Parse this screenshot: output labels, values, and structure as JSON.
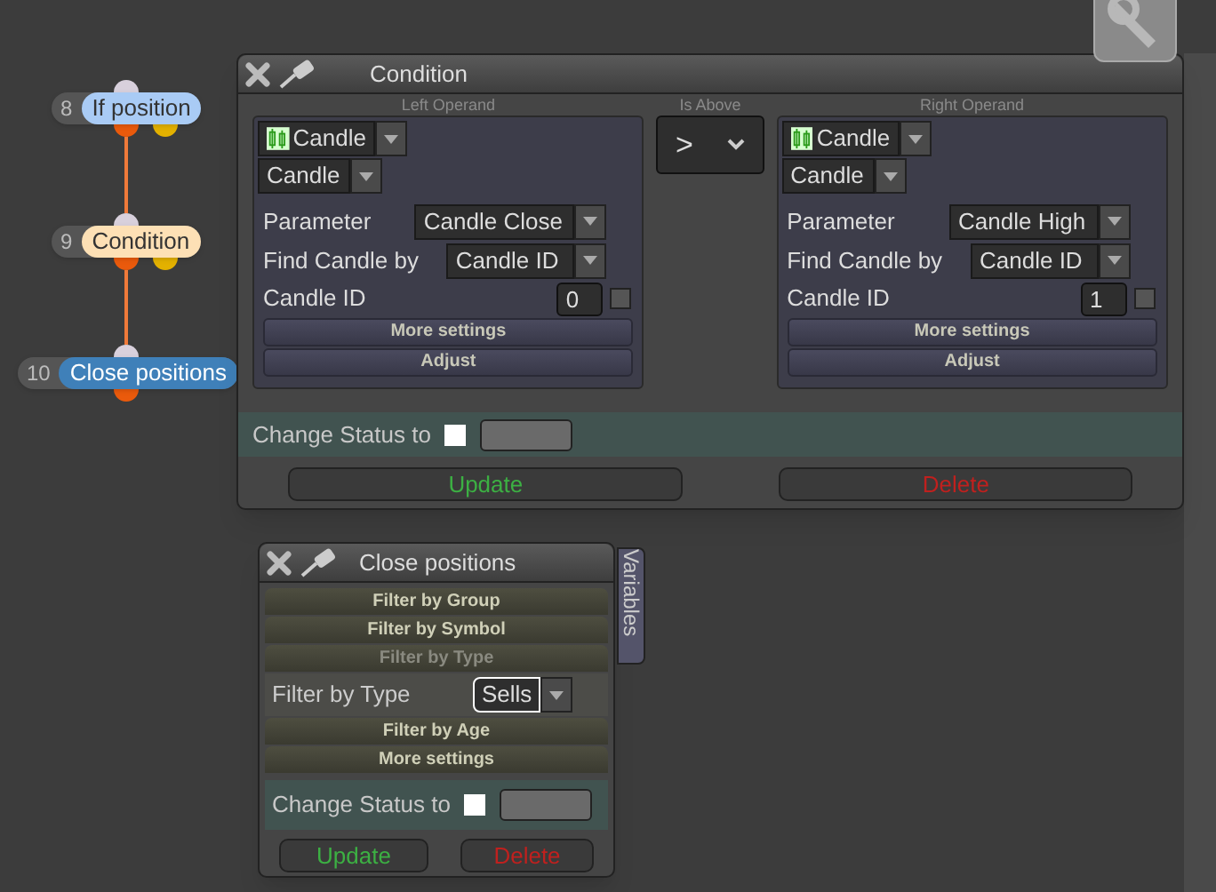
{
  "nodes": [
    {
      "number": "8",
      "label": "If position",
      "color": "#a9cbf5"
    },
    {
      "number": "9",
      "label": "Condition",
      "color": "#fde0b5"
    },
    {
      "number": "10",
      "label": "Close positions",
      "color": "#3f80b9"
    }
  ],
  "condition_panel": {
    "title": "Condition",
    "left_operand": {
      "heading": "Left Operand",
      "source": "Candle",
      "type": "Candle",
      "parameter_label": "Parameter",
      "parameter": "Candle Close",
      "find_label": "Find Candle by",
      "find": "Candle ID",
      "id_label": "Candle ID",
      "id_value": "0",
      "id_checked": false,
      "buttons": [
        "More settings",
        "Adjust"
      ]
    },
    "comparator": {
      "heading": "Is Above",
      "value": ">"
    },
    "right_operand": {
      "heading": "Right Operand",
      "source": "Candle",
      "type": "Candle",
      "parameter_label": "Parameter",
      "parameter": "Candle High",
      "find_label": "Find Candle by",
      "find": "Candle ID",
      "id_label": "Candle ID",
      "id_value": "1",
      "id_checked": false,
      "buttons": [
        "More settings",
        "Adjust"
      ]
    },
    "change_status": {
      "label": "Change Status to",
      "checked": false
    },
    "update": "Update",
    "delete": "Delete"
  },
  "close_panel": {
    "title": "Close positions",
    "side_tab": "Variables",
    "sections": [
      {
        "label": "Filter by Group",
        "expanded": false
      },
      {
        "label": "Filter by Symbol",
        "expanded": false
      },
      {
        "label": "Filter by Type",
        "expanded": true,
        "field_label": "Filter by Type",
        "value": "Sells"
      },
      {
        "label": "Filter by Age",
        "expanded": false
      },
      {
        "label": "More settings",
        "expanded": false
      }
    ],
    "change_status": {
      "label": "Change Status to",
      "checked": false
    },
    "update": "Update",
    "delete": "Delete"
  }
}
